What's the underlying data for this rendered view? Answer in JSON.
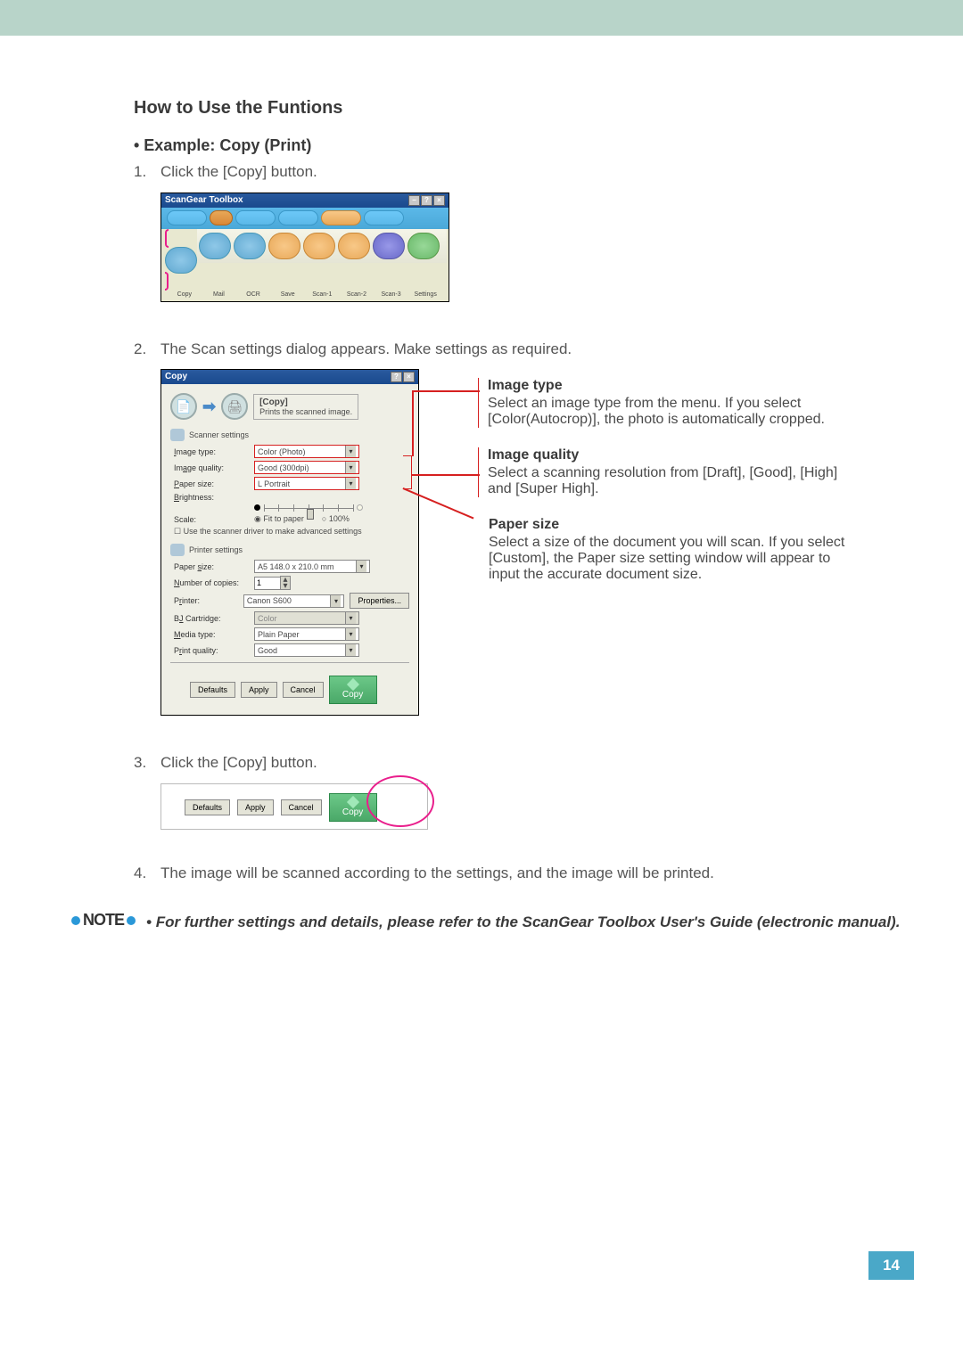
{
  "topbar": {},
  "headings": {
    "h1": "How to Use the Funtions",
    "h2": "• Example: Copy (Print)"
  },
  "steps": {
    "s1num": "1.",
    "s1": "Click the [Copy] button.",
    "s2num": "2.",
    "s2": "The Scan settings dialog appears. Make settings as required.",
    "s3num": "3.",
    "s3": "Click the [Copy] button.",
    "s4num": "4.",
    "s4": "The image will be scanned according to the settings, and the image will be printed."
  },
  "toolbox": {
    "title": "ScanGear Toolbox",
    "labels": [
      "Copy",
      "Mail",
      "OCR",
      "Save",
      "Scan-1",
      "Scan-2",
      "Scan-3",
      "Settings"
    ]
  },
  "copyDialog": {
    "title": "Copy",
    "headerLabel": "[Copy]",
    "headerDesc": "Prints the scanned image.",
    "scannerSection": "Scanner settings",
    "imageTypeLabel": "Image type:",
    "imageType": "Color (Photo)",
    "imageQualityLabel": "Image quality:",
    "imageQuality": "Good (300dpi)",
    "paperSizeLabel": "Paper size:",
    "paperSize": "L Portrait",
    "brightnessLabel": "Brightness:",
    "scaleLabel": "Scale:",
    "fitToPaper": "Fit to paper",
    "pct100": "100%",
    "advanced": "Use the scanner driver to make advanced settings",
    "printerSection": "Printer settings",
    "paperSize2Label": "Paper size:",
    "paperSize2": "A5 148.0 x 210.0 mm",
    "copiesLabel": "Number of copies:",
    "copies": "1",
    "printerLabel": "Printer:",
    "printer": "Canon S600",
    "propertiesBtn": "Properties...",
    "cartridgeLabel": "BJ Cartridge:",
    "cartridge": "Color",
    "mediaLabel": "Media type:",
    "media": "Plain Paper",
    "printQualityLabel": "Print quality:",
    "printQuality": "Good",
    "defaultsBtn": "Defaults",
    "applyBtn": "Apply",
    "cancelBtn": "Cancel",
    "copyBtn": "Copy"
  },
  "annotations": {
    "imageType": {
      "title": "Image type",
      "body": "Select an image type from the menu. If you select [Color(Autocrop)], the photo is automatically cropped."
    },
    "imageQuality": {
      "title": "Image quality",
      "body": "Select a scanning resolution from [Draft], [Good], [High] and [Super High]."
    },
    "paperSize": {
      "title": "Paper size",
      "body": "Select a size of the document you will scan. If you select [Custom], the Paper size setting window will appear to input the accurate document size."
    }
  },
  "note": {
    "label": "NOTE",
    "text": "For further settings and details, please refer to the ScanGear Toolbox User's Guide (electronic manual)."
  },
  "pageNumber": "14"
}
